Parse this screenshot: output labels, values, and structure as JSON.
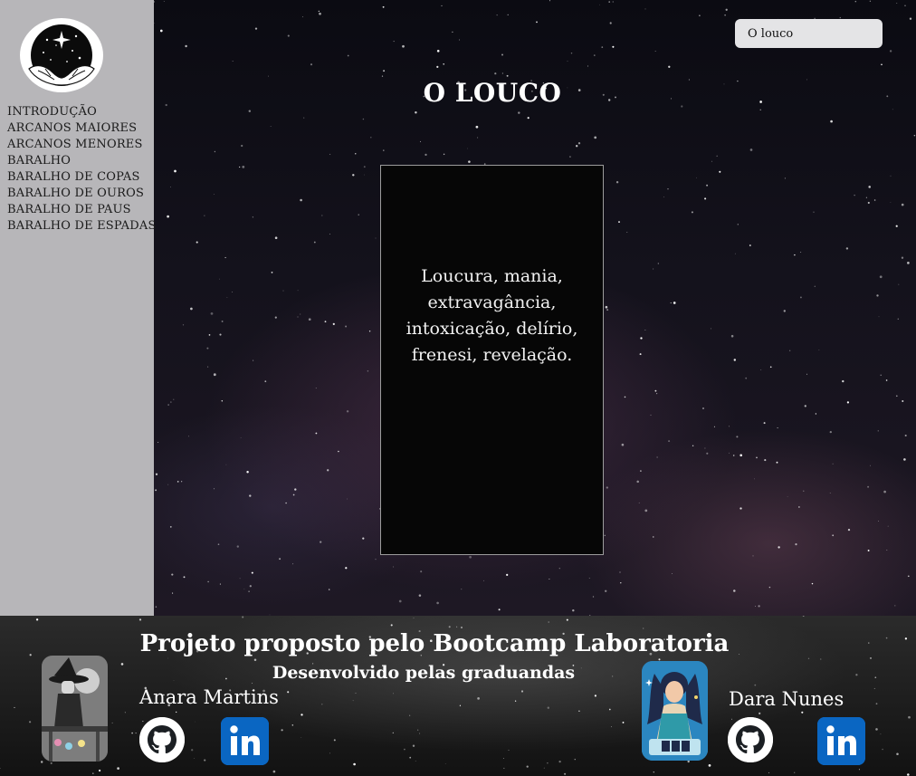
{
  "sidebar": {
    "logo_icon": "hands-night-sky-logo-icon",
    "items": [
      {
        "label": "INTRODUÇÃO"
      },
      {
        "label": "ARCANOS MAIORES"
      },
      {
        "label": "ARCANOS MENORES"
      },
      {
        "label": "BARALHO"
      },
      {
        "label": "BARALHO DE COPAS"
      },
      {
        "label": "BARALHO DE OUROS"
      },
      {
        "label": "BARALHO DE PAUS"
      },
      {
        "label": "BARALHO DE ESPADAS"
      }
    ]
  },
  "search": {
    "value": "O louco"
  },
  "main": {
    "title": "O LOUCO",
    "card_text": "Loucura, mania, extravagância, intoxicação, delírio, frenesi, revelação."
  },
  "footer": {
    "title": "Projeto proposto pelo Bootcamp Laboratoria",
    "subtitle": "Desenvolvido pelas graduandas",
    "authors": [
      {
        "name": "Anara Martins",
        "avatar_icon": "witch-illustration-avatar",
        "github_icon": "github-icon",
        "linkedin_icon": "linkedin-icon"
      },
      {
        "name": "Dara Nunes",
        "avatar_icon": "tarot-reader-illustration-avatar",
        "github_icon": "github-icon",
        "linkedin_icon": "linkedin-icon"
      }
    ]
  },
  "colors": {
    "sidebar_bg": "#b7b6b9",
    "card_bg": "#060606",
    "linkedin_blue": "#0a66c2",
    "search_bg": "#e4e4e6"
  }
}
